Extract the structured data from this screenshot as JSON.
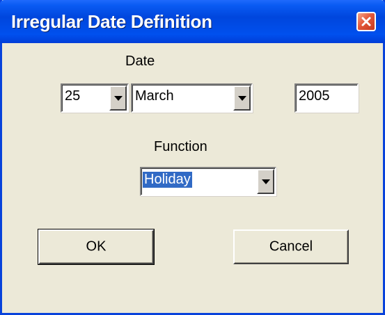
{
  "window": {
    "title": "Irregular Date Definition"
  },
  "date": {
    "label": "Date",
    "day": "25",
    "month": "March",
    "year": "2005"
  },
  "function": {
    "label": "Function",
    "selected": "Holiday"
  },
  "buttons": {
    "ok_label": "OK",
    "cancel_label": "Cancel"
  },
  "colors": {
    "titlebar": "#0046DD",
    "dialog_face": "#ECE9D8",
    "selection": "#316AC5",
    "close_button": "#E3583A"
  }
}
